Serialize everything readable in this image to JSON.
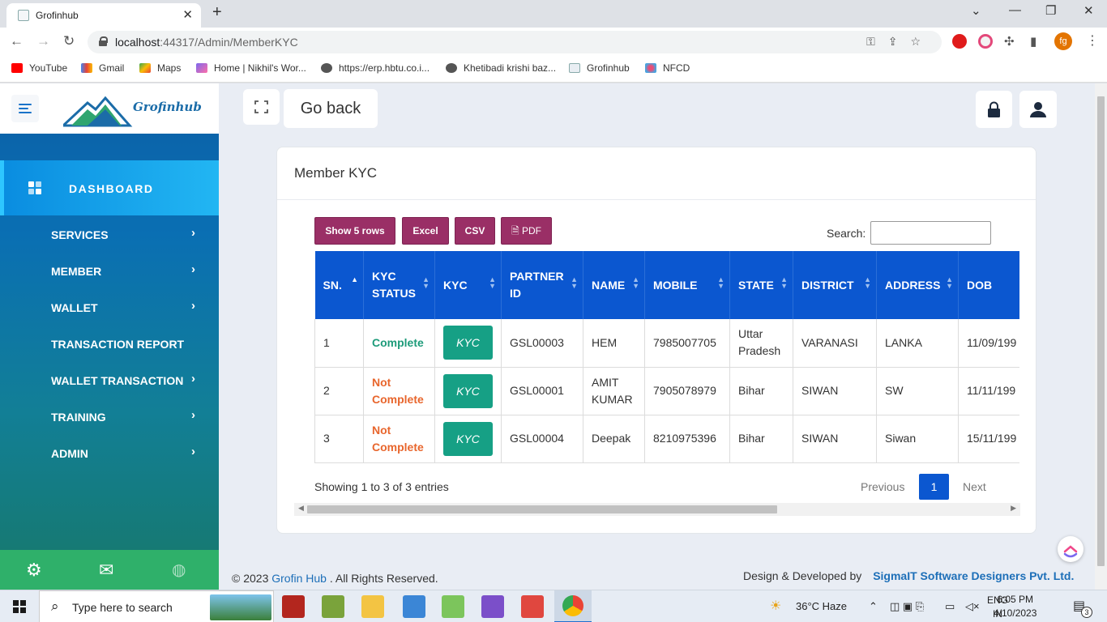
{
  "browser": {
    "tab_title": "Grofinhub",
    "url_host": "localhost",
    "url_rest": ":44317/Admin/MemberKYC",
    "profile_initials": "fg",
    "bookmarks": [
      "YouTube",
      "Gmail",
      "Maps",
      "Home | Nikhil's Wor...",
      "https://erp.hbtu.co.i...",
      "Khetibadi krishi baz...",
      "Grofinhub",
      "NFCD"
    ]
  },
  "sidebar": {
    "logo_text": "Grofinhub",
    "dashboard_label": "DASHBOARD",
    "items": [
      {
        "label": "SERVICES",
        "chevron": "›"
      },
      {
        "label": "MEMBER",
        "chevron": "›"
      },
      {
        "label": "WALLET",
        "chevron": "›"
      },
      {
        "label": "TRANSACTION REPORT",
        "chevron": ""
      },
      {
        "label": "WALLET TRANSACTION",
        "chevron": "›"
      },
      {
        "label": "TRAINING",
        "chevron": "›"
      },
      {
        "label": "ADMIN",
        "chevron": "›"
      }
    ]
  },
  "topbar": {
    "go_back_label": "Go back"
  },
  "card": {
    "title": "Member KYC",
    "buttons": {
      "show_rows": "Show 5 rows",
      "excel": "Excel",
      "csv": "CSV",
      "pdf": "PDF"
    },
    "search_label": "Search:",
    "search_value": "",
    "columns": [
      "SN.",
      "KYC STATUS",
      "KYC",
      "PARTNER ID",
      "NAME",
      "MOBILE",
      "STATE",
      "DISTRICT",
      "ADDRESS",
      "DOB"
    ],
    "rows": [
      {
        "sn": "1",
        "status": "Complete",
        "status_type": "ok",
        "kyc": "KYC",
        "partner_id": "GSL00003",
        "name": "HEM",
        "mobile": "7985007705",
        "state": "Uttar Pradesh",
        "district": "VARANASI",
        "address": "LANKA",
        "dob": "11/09/199"
      },
      {
        "sn": "2",
        "status": "Not Complete",
        "status_type": "no",
        "kyc": "KYC",
        "partner_id": "GSL00001",
        "name": "AMIT KUMAR",
        "mobile": "7905078979",
        "state": "Bihar",
        "district": "SIWAN",
        "address": "SW",
        "dob": "11/11/199"
      },
      {
        "sn": "3",
        "status": "Not Complete",
        "status_type": "no",
        "kyc": "KYC",
        "partner_id": "GSL00004",
        "name": "Deepak",
        "mobile": "8210975396",
        "state": "Bihar",
        "district": "SIWAN",
        "address": "Siwan",
        "dob": "15/11/199"
      }
    ],
    "info": "Showing 1 to 3 of 3 entries",
    "pagination": {
      "previous": "Previous",
      "current": "1",
      "next": "Next"
    }
  },
  "footer": {
    "copyright_prefix": "© 2023",
    "copyright_brand": "Grofin Hub",
    "copyright_suffix": ". All Rights Reserved.",
    "design_label": "Design & Developed by",
    "design_brand": "SigmaIT Software Designers Pvt. Ltd."
  },
  "taskbar": {
    "search_placeholder": "Type here to search",
    "weather": "36°C  Haze",
    "lang_top": "ENG",
    "lang_bottom": "IN",
    "time": "6:05 PM",
    "date": "4/10/2023",
    "notification_count": "3"
  }
}
